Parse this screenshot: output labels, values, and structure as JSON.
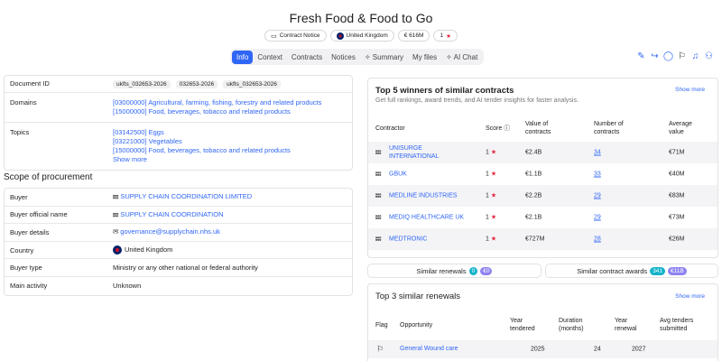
{
  "title": "Fresh Food & Food to Go",
  "badges": {
    "notice": "Contract Notice",
    "country": "United Kingdom",
    "value": "€ 616M",
    "score": "1"
  },
  "tabs": [
    "Info",
    "Context",
    "Contracts",
    "Notices",
    "Summary",
    "My files",
    "AI Chat"
  ],
  "details": {
    "document_id_label": "Document ID",
    "document_ids": [
      "ukfts_032653-2026",
      "032653-2026",
      "ukfts_032653-2026"
    ],
    "domains_label": "Domains",
    "domains": [
      "[03000000] Agricultural, farming, fishing, forestry and related products",
      "[15000000] Food, beverages, tobacco and related products"
    ],
    "topics_label": "Topics",
    "topics": [
      "[03142500] Eggs",
      "[03221000] Vegetables",
      "[15000000] Food, beverages, tobacco and related products"
    ],
    "show_more": "Show more"
  },
  "scope": {
    "title": "Scope of procurement",
    "rows": [
      {
        "label": "Buyer",
        "value": "SUPPLY CHAIN COORDINATION LIMITED"
      },
      {
        "label": "Buyer official name",
        "value": "SUPPLY CHAIN COORDINATION"
      },
      {
        "label": "Buyer details",
        "value": "governance@supplychain.nhs.uk"
      },
      {
        "label": "Country",
        "value": "United Kingdom"
      },
      {
        "label": "Buyer type",
        "value": "Ministry or any other national or federal authority"
      },
      {
        "label": "Main activity",
        "value": "Unknown"
      }
    ]
  },
  "winners": {
    "title": "Top 5 winners of similar contracts",
    "subtitle": "Get full rankings, award trends, and AI tender insights for faster analysis.",
    "show_more": "Show more",
    "headers": {
      "contractor": "Contractor",
      "score": "Score ⓘ",
      "value_1": "Value of",
      "value_2": "contracts",
      "number_1": "Number of",
      "number_2": "contracts",
      "avg_1": "Average",
      "avg_2": "value"
    },
    "rows": [
      {
        "name_1": "UNISURGE",
        "name_2": "INTERNATIONAL",
        "score": "1",
        "value": "€2.4B",
        "number": "34",
        "avg": "€71M"
      },
      {
        "name_1": "GBUK",
        "name_2": "",
        "score": "1",
        "value": "€1.1B",
        "number": "33",
        "avg": "€40M"
      },
      {
        "name_1": "MEDLINE INDUSTRIES",
        "name_2": "",
        "score": "1",
        "value": "€2.2B",
        "number": "29",
        "avg": "€83M"
      },
      {
        "name_1": "MEDIQ HEALTHCARE UK",
        "name_2": "",
        "score": "1",
        "value": "€2.1B",
        "number": "29",
        "avg": "€73M"
      },
      {
        "name_1": "MEDTRONIC",
        "name_2": "",
        "score": "1",
        "value": "€727M",
        "number": "28",
        "avg": "€26M"
      }
    ]
  },
  "similar": {
    "renewals_label": "Similar renewals",
    "renewals_count": "0",
    "renewals_value": "€0",
    "awards_label": "Similar contract awards",
    "awards_count": "341",
    "awards_value": "€11B"
  },
  "renewals": {
    "title": "Top 3 similar renewals",
    "show_more": "Show more",
    "headers": {
      "flag": "Flag",
      "opportunity": "Opportunity",
      "year_t1": "Year",
      "year_t2": "tendered",
      "dur1": "Duration",
      "dur2": "(months)",
      "year_r1": "Year",
      "year_r2": "renewal",
      "avg1": "Avg tenders",
      "avg2": "submitted"
    },
    "rows": [
      {
        "opportunity": "General Wound care",
        "year_tendered": "2025",
        "duration": "24",
        "year_renewal": "2027",
        "avg": ""
      }
    ]
  }
}
